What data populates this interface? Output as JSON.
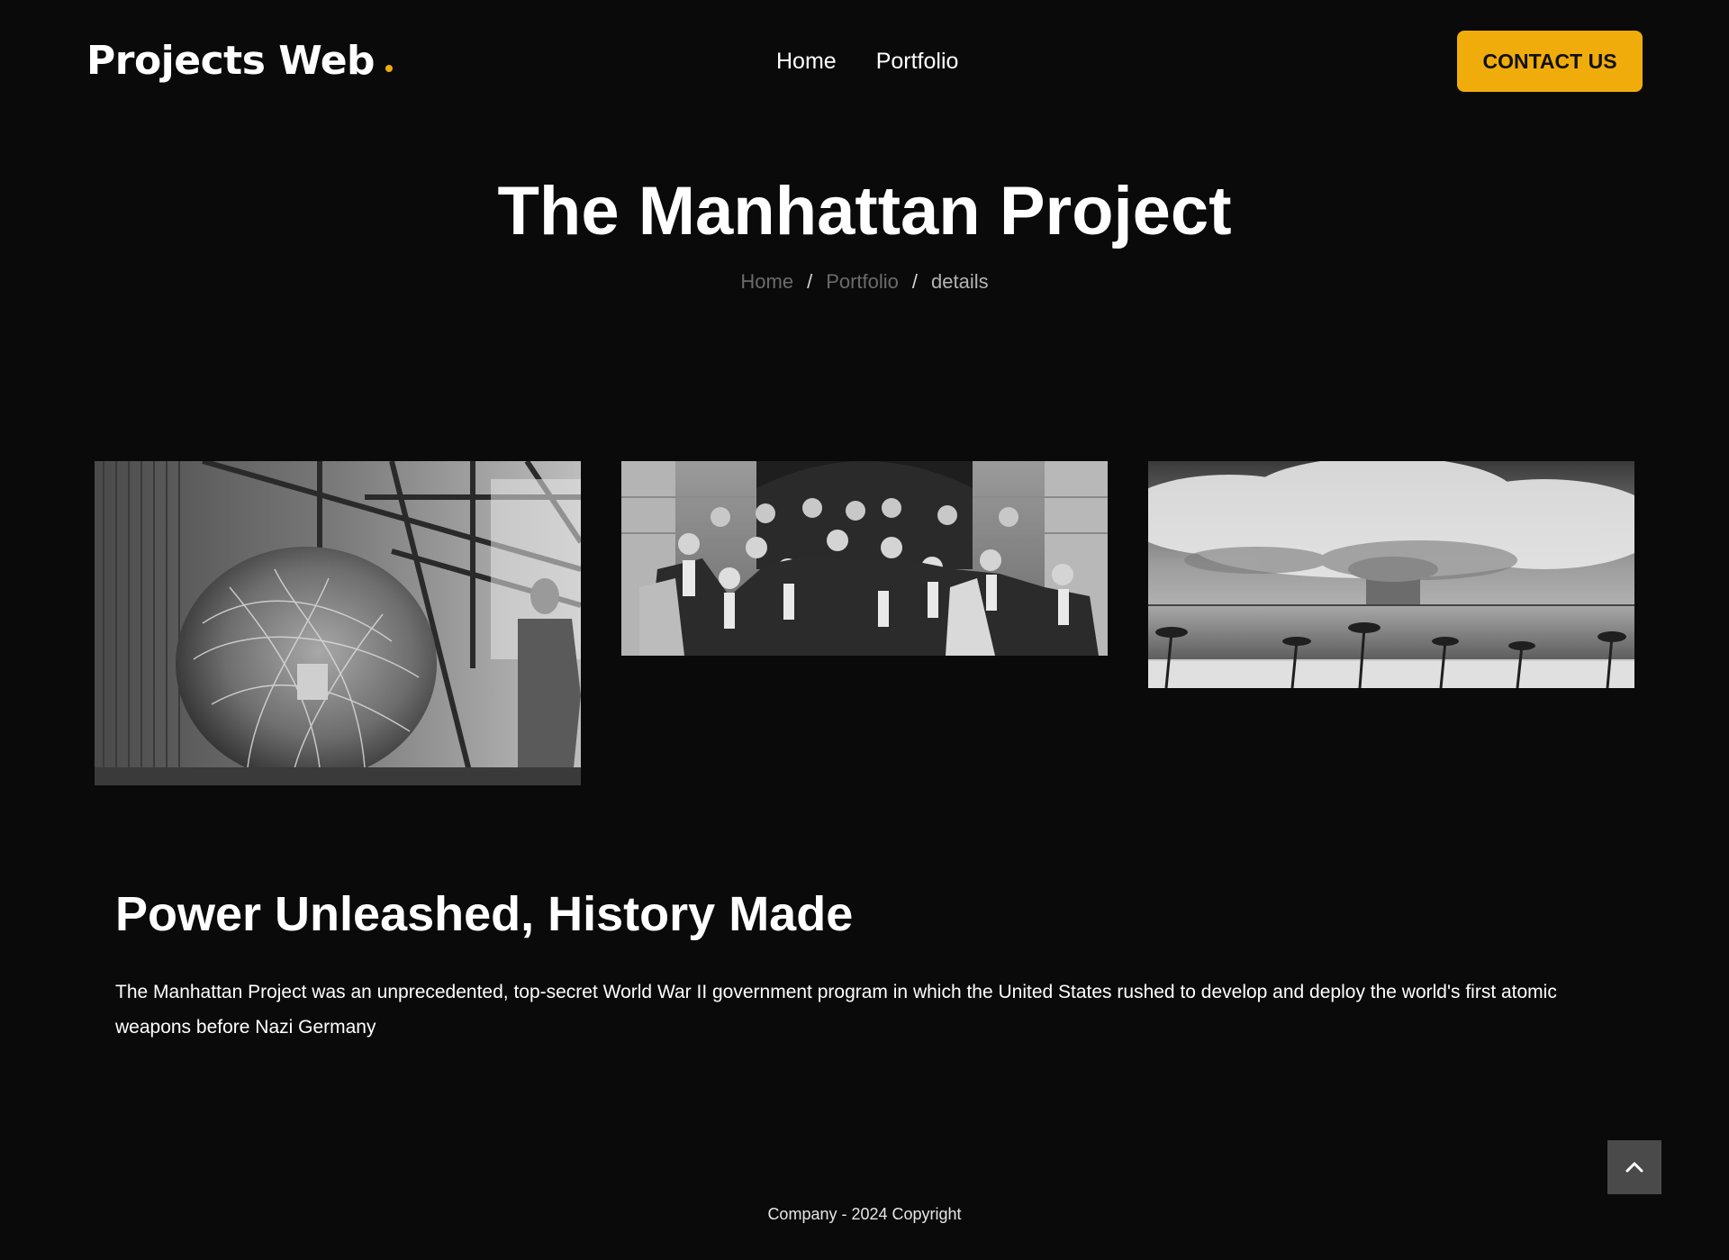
{
  "header": {
    "logo": "Projects Web",
    "nav": [
      {
        "label": "Home"
      },
      {
        "label": "Portfolio"
      }
    ],
    "contact_label": "CONTACT US"
  },
  "hero": {
    "title": "The Manhattan Project",
    "breadcrumb": {
      "home": "Home",
      "separator": "/",
      "portfolio": "Portfolio",
      "current": "details"
    }
  },
  "gallery": [
    {
      "subject": "gadget-device-photo"
    },
    {
      "subject": "scientists-group-photo"
    },
    {
      "subject": "mushroom-cloud-photo"
    }
  ],
  "content": {
    "title": "Power Unleashed, History Made",
    "text": "The Manhattan Project was an unprecedented, top-secret World War II government program in which the United States rushed to develop and deploy the world's first atomic weapons before Nazi Germany"
  },
  "footer": {
    "copyright": "Company - 2024 Copyright"
  },
  "colors": {
    "background": "#0a0a0a",
    "accent": "#f0ac0a"
  },
  "icons": {
    "back_to_top": "chevron-up-icon"
  }
}
